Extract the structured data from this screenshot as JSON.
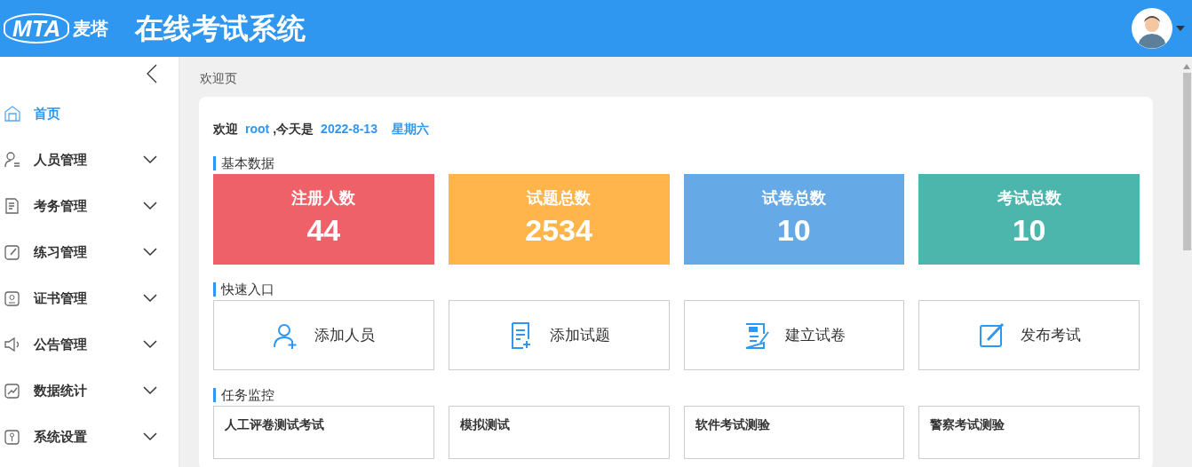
{
  "header": {
    "logo_text": "MTA",
    "logo_brand": "麦塔",
    "title": "在线考试系统"
  },
  "sidebar": {
    "items": [
      {
        "label": "首页",
        "selected": true,
        "expandable": false
      },
      {
        "label": "人员管理",
        "selected": false,
        "expandable": true
      },
      {
        "label": "考务管理",
        "selected": false,
        "expandable": true
      },
      {
        "label": "练习管理",
        "selected": false,
        "expandable": true
      },
      {
        "label": "证书管理",
        "selected": false,
        "expandable": true
      },
      {
        "label": "公告管理",
        "selected": false,
        "expandable": true
      },
      {
        "label": "数据统计",
        "selected": false,
        "expandable": true
      },
      {
        "label": "系统设置",
        "selected": false,
        "expandable": true
      }
    ]
  },
  "breadcrumb": "欢迎页",
  "welcome": {
    "prefix": "欢迎",
    "user": "root",
    "middle": ",今天是",
    "date": "2022-8-13",
    "weekday": "星期六"
  },
  "stats": {
    "title": "基本数据",
    "cards": [
      {
        "label": "注册人数",
        "value": "44",
        "color": "#ee6168"
      },
      {
        "label": "试题总数",
        "value": "2534",
        "color": "#ffb54b"
      },
      {
        "label": "试卷总数",
        "value": "10",
        "color": "#65aae6"
      },
      {
        "label": "考试总数",
        "value": "10",
        "color": "#4db6ac"
      }
    ]
  },
  "quick": {
    "title": "快速入口",
    "items": [
      {
        "label": "添加人员"
      },
      {
        "label": "添加试题"
      },
      {
        "label": "建立试卷"
      },
      {
        "label": "发布考试"
      }
    ]
  },
  "tasks": {
    "title": "任务监控",
    "items": [
      {
        "title": "人工评卷测试考试"
      },
      {
        "title": "模拟测试"
      },
      {
        "title": "软件考试测验"
      },
      {
        "title": "警察考试测验"
      }
    ]
  }
}
